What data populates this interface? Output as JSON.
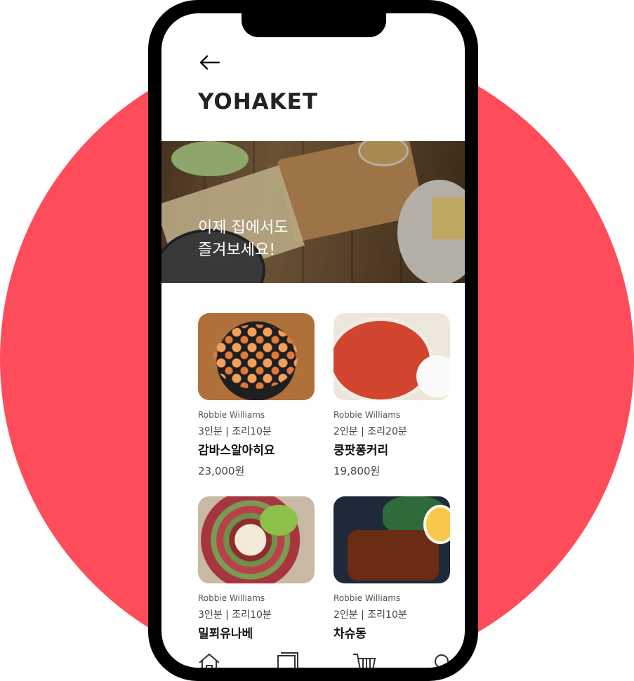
{
  "app": {
    "title": "YOHAKET"
  },
  "banner": {
    "line1": "이제 집에서도",
    "line2": "즐겨보세요!"
  },
  "products": [
    {
      "author": "Robbie Williams",
      "meta": "3인분 | 조리10분",
      "name": "감바스알아히요",
      "price": "23,000원"
    },
    {
      "author": "Robbie Williams",
      "meta": "2인분 | 조리20분",
      "name": "쿵팟퐁커리",
      "price": "19,800원"
    },
    {
      "author": "Robbie Williams",
      "meta": "3인분 | 조리10분",
      "name": "밀푀유나베",
      "price": ""
    },
    {
      "author": "Robbie Williams",
      "meta": "2인분 | 조리10분",
      "name": "차슈동",
      "price": ""
    }
  ],
  "tabbar": {
    "icons": [
      "home-icon",
      "recipe-book-icon",
      "cart-icon",
      "search-icon"
    ]
  },
  "colors": {
    "accent": "#ff4c5b",
    "phone_frame": "#000000",
    "text": "#111111"
  }
}
